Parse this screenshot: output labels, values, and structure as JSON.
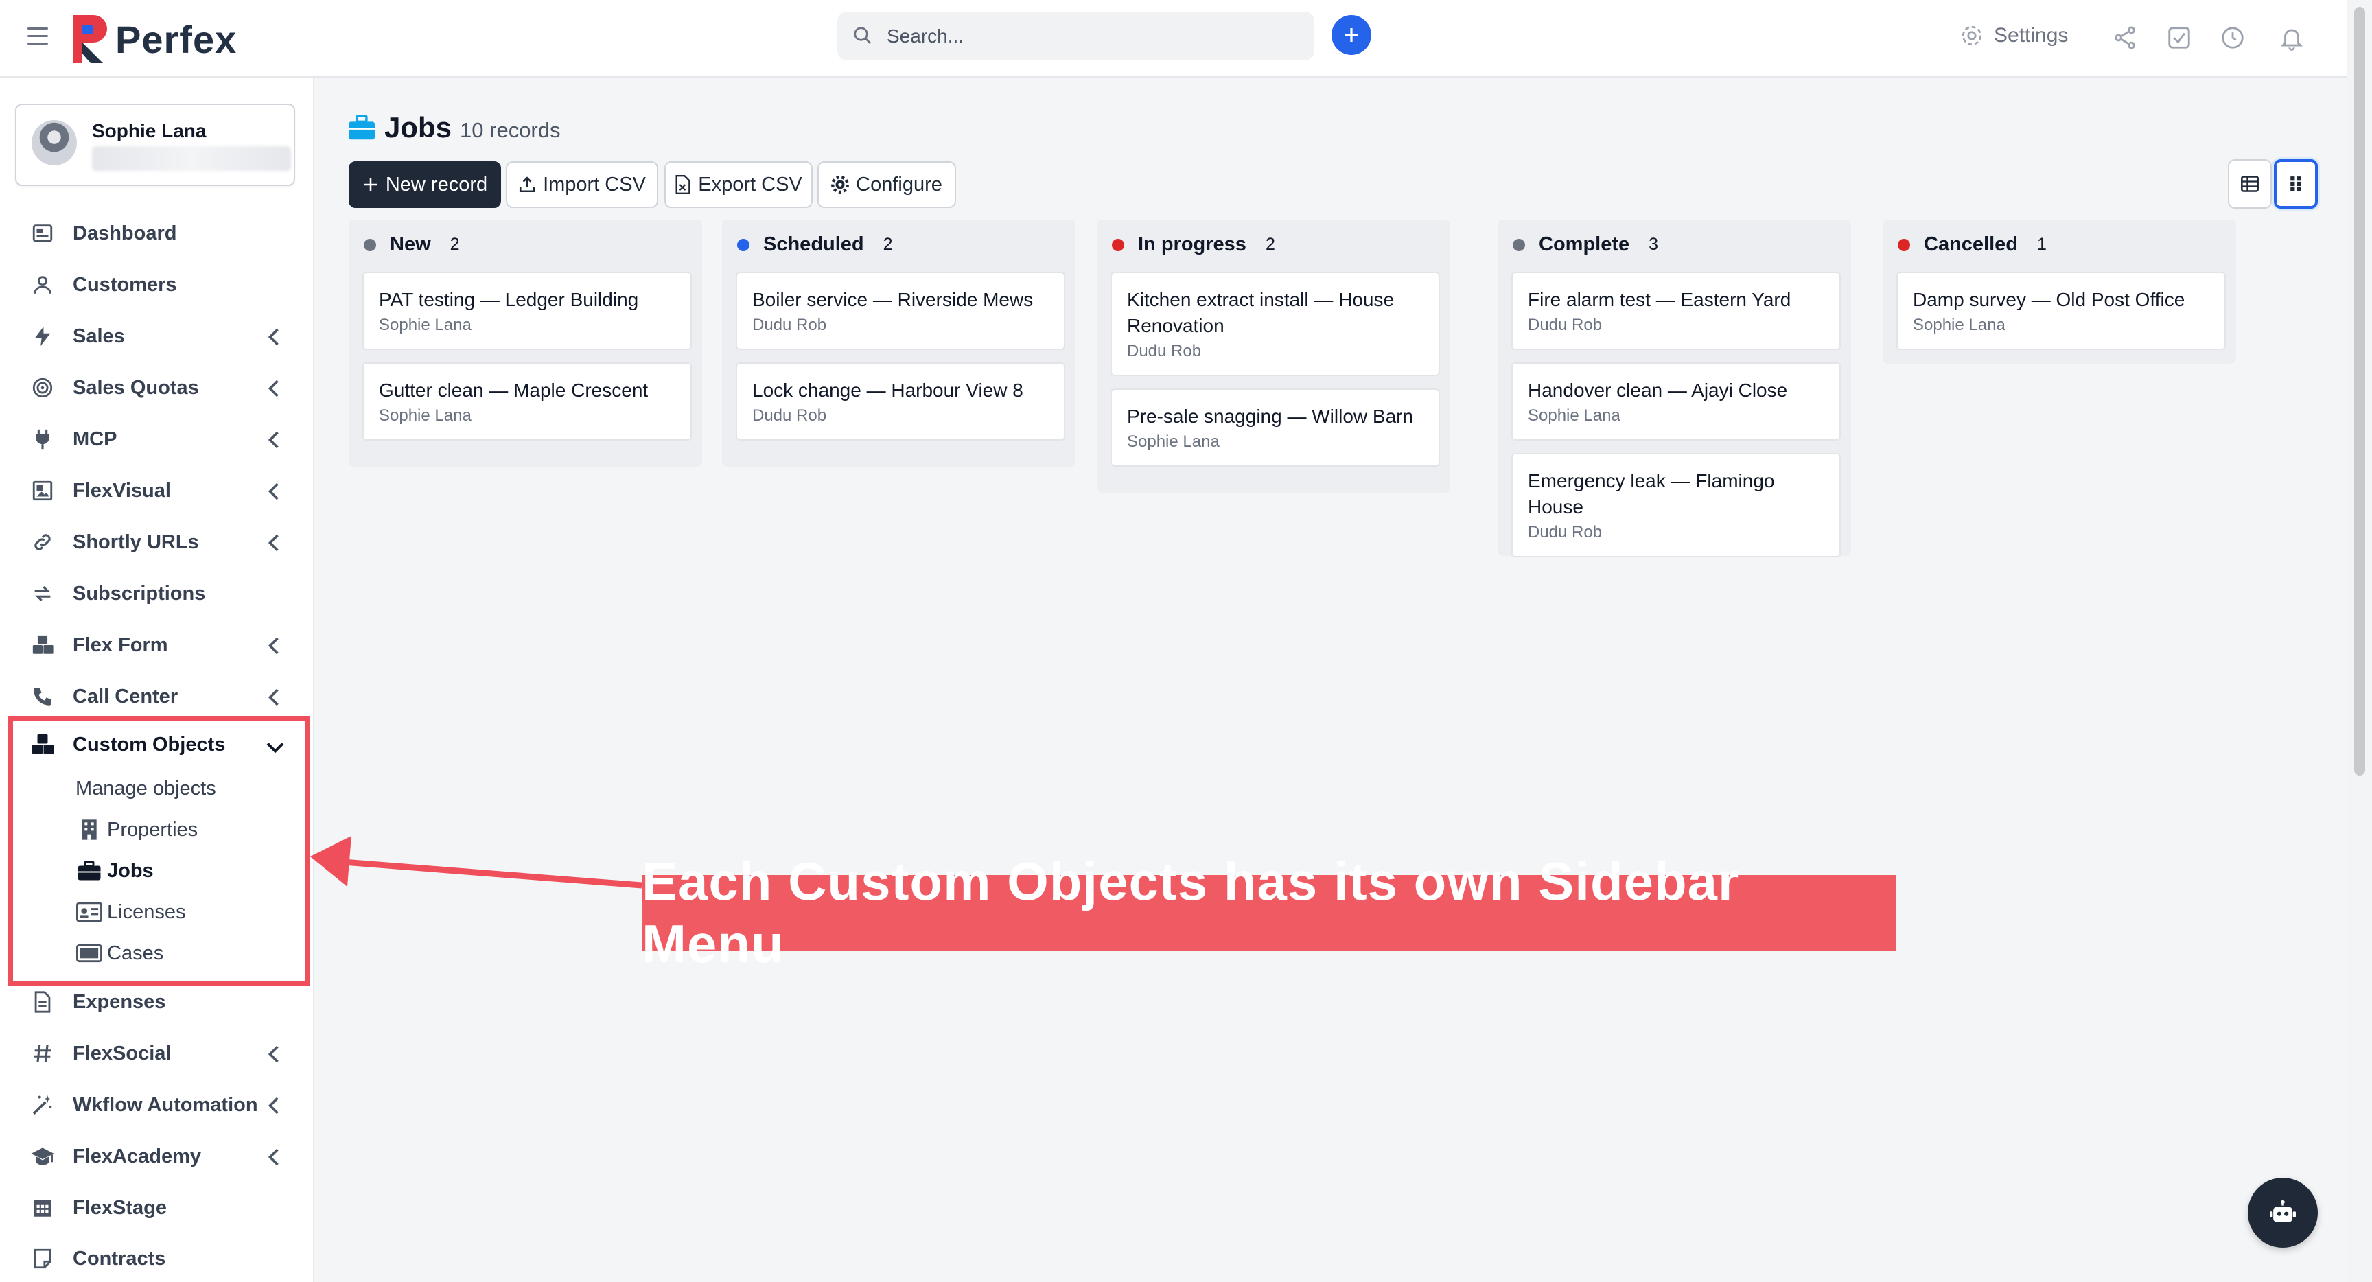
{
  "header": {
    "app_name": "Perfex",
    "search_placeholder": "Search...",
    "settings_label": "Settings",
    "accent": "#2563eb",
    "logo_colors": [
      "#e63946",
      "#2563eb",
      "#243043"
    ]
  },
  "user": {
    "name": "Sophie Lana"
  },
  "sidebar": {
    "items": [
      {
        "label": "Dashboard",
        "icon": "dashboard-icon",
        "chevron": false
      },
      {
        "label": "Customers",
        "icon": "user-icon",
        "chevron": false
      },
      {
        "label": "Sales",
        "icon": "bolt-icon",
        "chevron": true
      },
      {
        "label": "Sales Quotas",
        "icon": "target-icon",
        "chevron": true
      },
      {
        "label": "MCP",
        "icon": "plug-icon",
        "chevron": true
      },
      {
        "label": "FlexVisual",
        "icon": "image-icon",
        "chevron": true
      },
      {
        "label": "Shortly URLs",
        "icon": "link-icon",
        "chevron": true
      },
      {
        "label": "Subscriptions",
        "icon": "refresh-icon",
        "chevron": false
      },
      {
        "label": "Flex Form",
        "icon": "cubes-icon",
        "chevron": true
      },
      {
        "label": "Call Center",
        "icon": "phone-icon",
        "chevron": true
      },
      {
        "label": "Custom Objects",
        "icon": "cubes-icon",
        "chevron": true,
        "expanded": true
      }
    ],
    "custom_objects_sub": [
      {
        "label": "Manage objects",
        "icon": ""
      },
      {
        "label": "Properties",
        "icon": "building-icon"
      },
      {
        "label": "Jobs",
        "icon": "briefcase-icon",
        "active": true
      },
      {
        "label": "Licenses",
        "icon": "id-card-icon"
      },
      {
        "label": "Cases",
        "icon": "case-icon"
      }
    ],
    "items_after": [
      {
        "label": "Expenses",
        "icon": "file-icon",
        "chevron": false
      },
      {
        "label": "FlexSocial",
        "icon": "hash-icon",
        "chevron": true
      },
      {
        "label": "Wkflow Automation",
        "icon": "wand-icon",
        "chevron": true
      },
      {
        "label": "FlexAcademy",
        "icon": "graduation-icon",
        "chevron": true
      },
      {
        "label": "FlexStage",
        "icon": "calendar-icon",
        "chevron": false
      },
      {
        "label": "Contracts",
        "icon": "contract-icon",
        "chevron": false
      }
    ]
  },
  "page": {
    "title": "Jobs",
    "count": "10 records",
    "buttons": {
      "new_record": "New record",
      "import_csv": "Import CSV",
      "export_csv": "Export CSV",
      "configure": "Configure"
    }
  },
  "kanban": {
    "columns": [
      {
        "name": "New",
        "count": "2",
        "color": "#6b7280",
        "cards": [
          {
            "title": "PAT testing — Ledger Building",
            "owner": "Sophie Lana"
          },
          {
            "title": "Gutter clean — Maple Crescent",
            "owner": "Sophie Lana"
          }
        ]
      },
      {
        "name": "Scheduled",
        "count": "2",
        "color": "#2563eb",
        "cards": [
          {
            "title": "Boiler service — Riverside Mews",
            "owner": "Dudu Rob"
          },
          {
            "title": "Lock change — Harbour View 8",
            "owner": "Dudu Rob"
          }
        ]
      },
      {
        "name": "In progress",
        "count": "2",
        "color": "#dc2626",
        "cards": [
          {
            "title": "Kitchen extract install — House Renovation",
            "owner": "Dudu Rob"
          },
          {
            "title": "Pre-sale snagging — Willow Barn",
            "owner": "Sophie Lana"
          }
        ]
      },
      {
        "name": "Complete",
        "count": "3",
        "color": "#6b7280",
        "cards": [
          {
            "title": "Fire alarm test — Eastern Yard",
            "owner": "Dudu Rob"
          },
          {
            "title": "Handover clean — Ajayi Close",
            "owner": "Sophie Lana"
          },
          {
            "title": "Emergency leak — Flamingo House",
            "owner": "Dudu Rob"
          }
        ]
      },
      {
        "name": "Cancelled",
        "count": "1",
        "color": "#dc2626",
        "cards": [
          {
            "title": "Damp survey — Old Post Office",
            "owner": "Sophie Lana"
          }
        ]
      }
    ]
  },
  "annotation": {
    "text": "Each Custom Objects has its own Sidebar Menu",
    "color": "#ef5a63"
  }
}
